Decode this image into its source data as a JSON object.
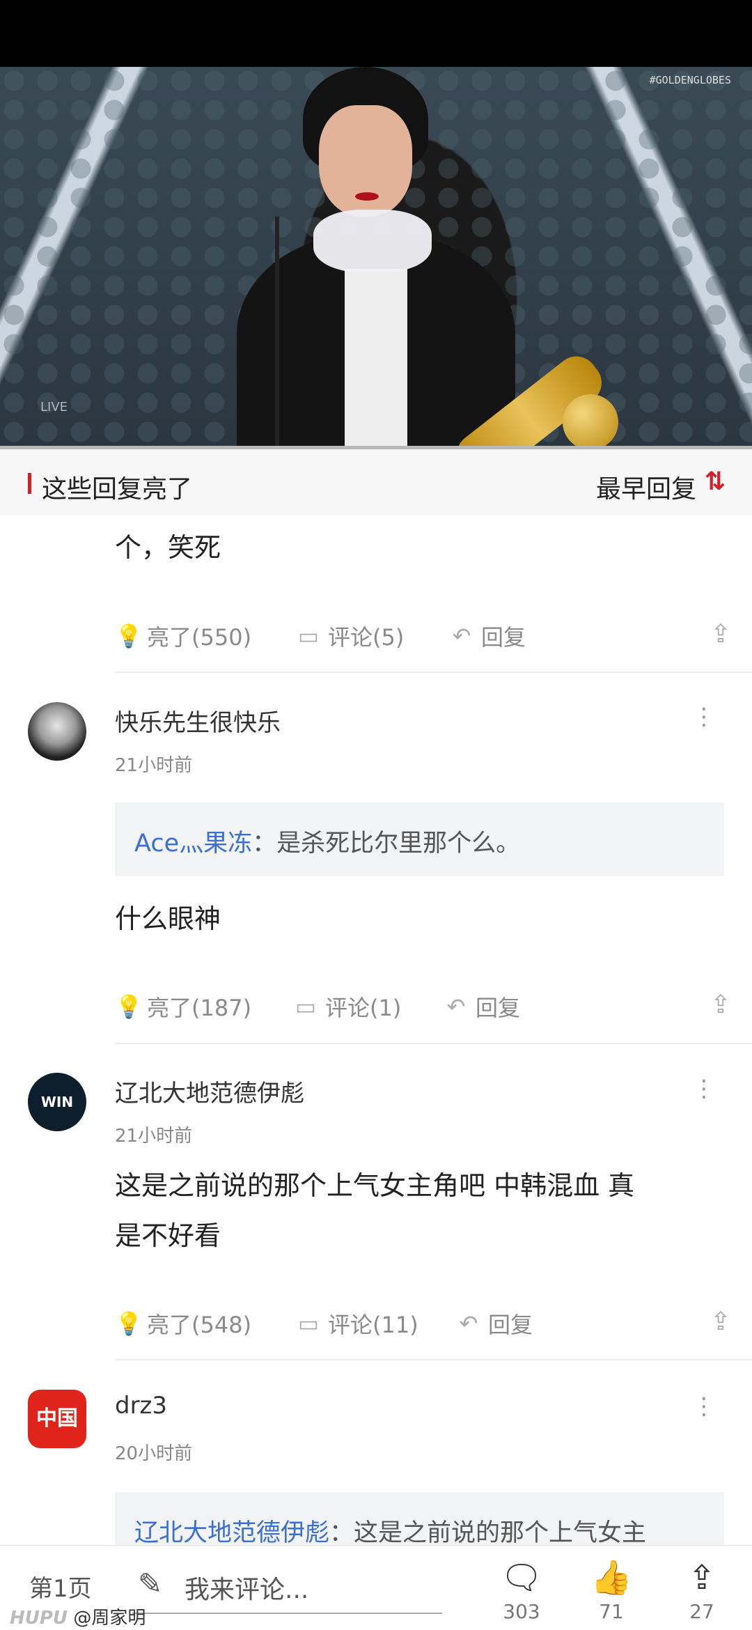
{
  "video": {
    "tag": "#GOLDENGLOBES",
    "live": "LIVE"
  },
  "section": {
    "title": "这些回复亮了",
    "sort_label": "最早回复",
    "sort_icon": "⇅"
  },
  "comments": [
    {
      "text": "个，笑死",
      "likes": "亮了(550)",
      "comments": "评论(5)",
      "reply": "回复"
    },
    {
      "user": "快乐先生很快乐",
      "time": "21小时前",
      "quote_name": "Ace灬果冻",
      "quote_text": "：是杀死比尔里那个么。",
      "text": "什么眼神",
      "likes": "亮了(187)",
      "comments": "评论(1)",
      "reply": "回复"
    },
    {
      "user": "辽北大地范德伊彪",
      "time": "21小时前",
      "avatar_text": "WIN",
      "text_line1": "这是之前说的那个上气女主角吧 中韩混血 真",
      "text_line2": "是不好看",
      "likes": "亮了(548)",
      "comments": "评论(11)",
      "reply": "回复"
    },
    {
      "user": "drz3",
      "time": "20小时前",
      "avatar_text": "中国",
      "quote_name": "辽北大地范德伊彪",
      "quote_text": "：这是之前说的那个上气女主"
    }
  ],
  "bottom_bar": {
    "page": "第1页",
    "input_placeholder": "我来评论...",
    "comment_count": "303",
    "like_count": "71",
    "share_count": "27"
  },
  "watermark": {
    "brand": "HUPU",
    "author": "@周家明"
  },
  "icons": {
    "like": "like-bulb-icon",
    "comment": "comment-bubble-icon",
    "reply": "reply-arrow-icon",
    "share": "share-icon",
    "more": "more-vertical-icon",
    "pen": "pen-icon",
    "thumbs": "thumbs-up-icon"
  }
}
